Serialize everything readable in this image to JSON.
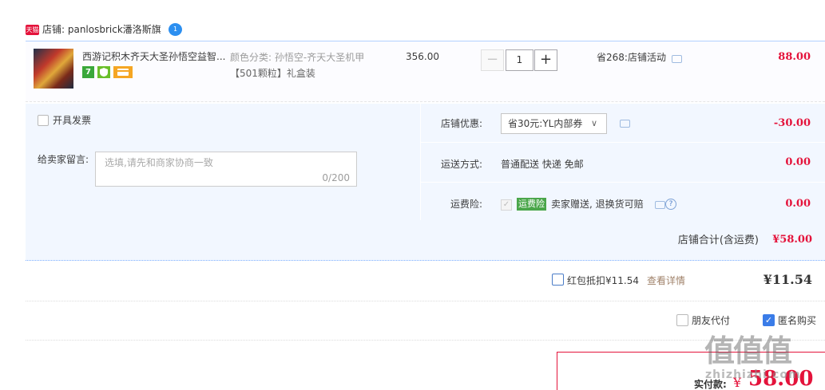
{
  "shop": {
    "badge": "天猫",
    "label": "店铺: panlosbrick潘洛斯旗",
    "wangwang_glyph": "1"
  },
  "item": {
    "title": "西游记积木齐天大圣孙悟空益智...",
    "badges": [
      "7",
      "",
      ""
    ],
    "sku_line1": "颜色分类: 孙悟空-齐天大圣机甲",
    "sku_line2": "【501颗粒】礼盒装",
    "price": "356.00",
    "quantity": "1",
    "qty_minus": "−",
    "qty_plus": "+",
    "promo": "省268:店铺活动",
    "total": "88.00"
  },
  "options": {
    "invoice_label": "开具发票",
    "message_label": "给卖家留言:",
    "message_placeholder": "选填,请先和商家协商一致",
    "message_count": "0/200",
    "shop_discount_label": "店铺优惠:",
    "coupon_selected": "省30元:YL内部券",
    "coupon_arrow": "∨",
    "discount_value": "-30.00",
    "shipping_label": "运送方式:",
    "shipping_text": "普通配送 快递 免邮",
    "shipping_value": "0.00",
    "insurance_label": "运费险:",
    "insurance_check": "✓",
    "insurance_tag": "运费险",
    "insurance_text": "卖家赠送, 退换货可赔",
    "help_glyph": "?",
    "insurance_value": "0.00"
  },
  "shop_total": {
    "label": "店铺合计(含运费)",
    "value": "¥58.00"
  },
  "red_packet": {
    "label": "红包抵扣¥11.54",
    "link": "查看详情",
    "value": "¥11.54"
  },
  "payment_options": {
    "friend_pay": "朋友代付",
    "anonymous": "匿名购买",
    "anonymous_check": "✓"
  },
  "pay": {
    "label": "实付款:",
    "currency": "¥",
    "value": "58.00"
  },
  "watermark": {
    "glyphs": "值值值",
    "text": "zhizhizhi.com"
  },
  "icons": {
    "tmall": "tmall-icon",
    "wangwang": "wangwang-chat-icon",
    "chat": "chat-bubble-icon",
    "help": "help-icon",
    "dropdown": "chevron-down-icon",
    "checkbox": "checkbox-icon"
  },
  "colors": {
    "accent_red": "#e4133b",
    "panel_blue": "#f2f7ff",
    "link_brown": "#a0826a",
    "insurance_green": "#4aa64a",
    "check_blue": "#3a7ce8"
  }
}
